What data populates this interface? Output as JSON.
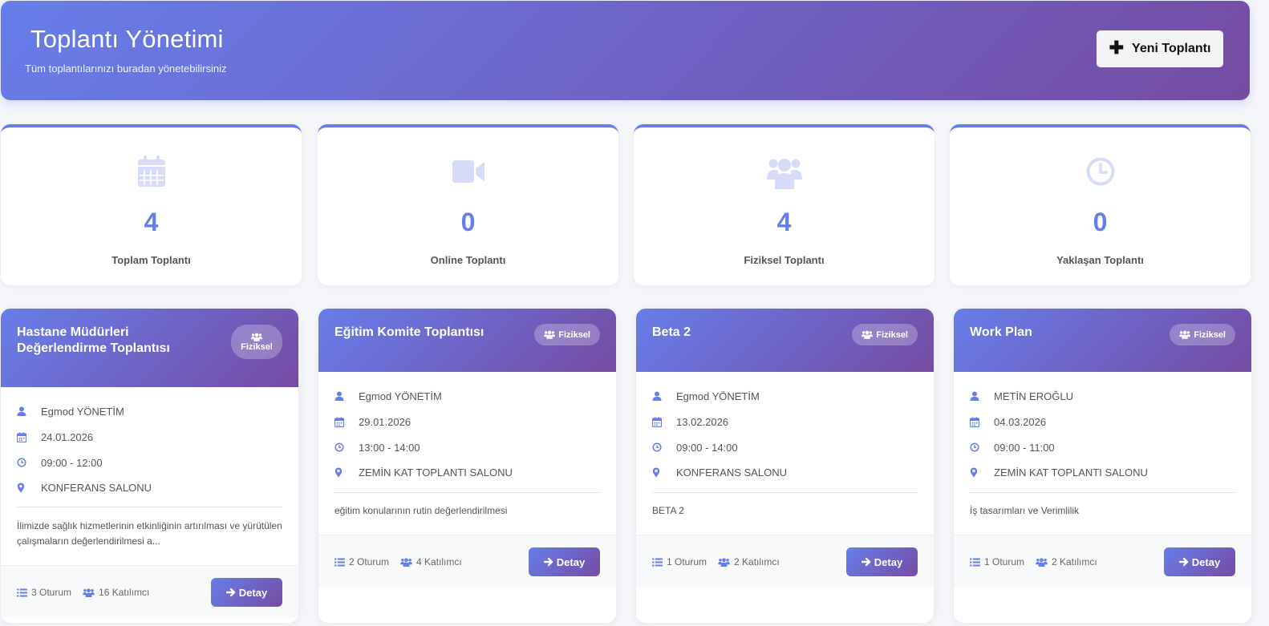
{
  "header": {
    "title": "Toplantı Yönetimi",
    "subtitle": "Tüm toplantılarınızı buradan yönetebilirsiniz",
    "new_button": "Yeni Toplantı"
  },
  "colors": {
    "accent": "#667eea",
    "accent_dark": "#764ba2",
    "icon_light": "#d6dbf8"
  },
  "stats": [
    {
      "icon": "calendar-icon",
      "value": "4",
      "label": "Toplam Toplantı"
    },
    {
      "icon": "video-camera-icon",
      "value": "0",
      "label": "Online Toplantı"
    },
    {
      "icon": "users-icon",
      "value": "4",
      "label": "Fiziksel Toplantı"
    },
    {
      "icon": "clock-icon",
      "value": "0",
      "label": "Yaklaşan Toplantı"
    }
  ],
  "meetings": [
    {
      "title": "Hastane Müdürleri Değerlendirme Toplantısı",
      "badge": "Fiziksel",
      "organizer": "Egmod YÖNETİM",
      "date": "24.01.2026",
      "time": "09:00 - 12:00",
      "location": "KONFERANS SALONU",
      "description": "İlimizde sağlık hizmetlerinin etkinliğinin artırılması ve yürütülen çalışmaların değerlendirilmesi a...",
      "sessions": "3 Oturum",
      "participants": "16 Katılımcı",
      "detail_button": "Detay"
    },
    {
      "title": "Eğitim Komite Toplantısı",
      "badge": "Fiziksel",
      "organizer": "Egmod YÖNETİM",
      "date": "29.01.2026",
      "time": "13:00 - 14:00",
      "location": "ZEMİN KAT TOPLANTI SALONU",
      "description": "eğitim konularının rutin değerlendirilmesi",
      "sessions": "2 Oturum",
      "participants": "4 Katılımcı",
      "detail_button": "Detay"
    },
    {
      "title": "Beta 2",
      "badge": "Fiziksel",
      "organizer": "Egmod YÖNETİM",
      "date": "13.02.2026",
      "time": "09:00 - 14:00",
      "location": "KONFERANS SALONU",
      "description": "BETA 2",
      "sessions": "1 Oturum",
      "participants": "2 Katılımcı",
      "detail_button": "Detay"
    },
    {
      "title": "Work Plan",
      "badge": "Fiziksel",
      "organizer": "METİN EROĞLU",
      "date": "04.03.2026",
      "time": "09:00 - 11:00",
      "location": "ZEMİN KAT TOPLANTI SALONU",
      "description": "İş tasarımları ve Verimlilik",
      "sessions": "1 Oturum",
      "participants": "2 Katılımcı",
      "detail_button": "Detay"
    }
  ]
}
